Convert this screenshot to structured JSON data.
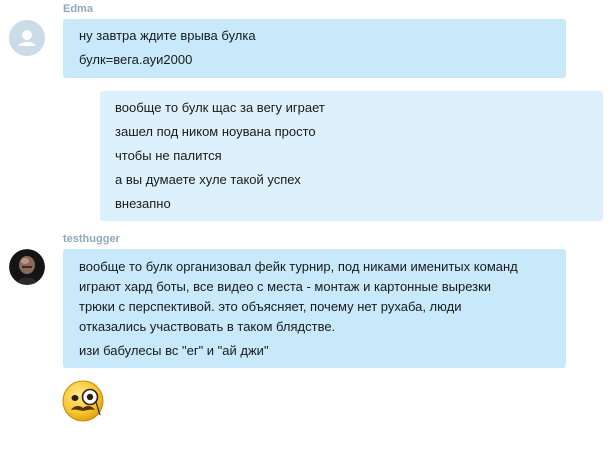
{
  "conversation": {
    "messages": [
      {
        "sender": "Edma",
        "lines": [
          "ну завтра ждите врыва булка",
          "булк=вега.ауи2000"
        ]
      },
      {
        "sender": "",
        "lines": [
          "вообще то булк щас за вегу играет",
          "зашел под ником ноувана просто",
          "чтобы не палится",
          "а вы думаете хуле такой успех",
          "внезапно"
        ]
      },
      {
        "sender": "testhugger",
        "lines": [
          "вообще то булк организовал фейк турнир, под никами именитых команд",
          "играют хард боты, все видео с места - монтаж и картонные вырезки",
          "трюки с перспективой. это объясняет, почему нет рухаба, люди",
          "отказались участвовать в таком блядстве.",
          "изи бабулесы вс \"ег\" и \"ай джи\""
        ]
      }
    ],
    "emoji": "monocle-smiley-icon",
    "colors": {
      "incoming_bubble": "#c7e9fa",
      "outgoing_bubble": "#dcf1fc",
      "sender_name": "#8fa9bb"
    }
  }
}
